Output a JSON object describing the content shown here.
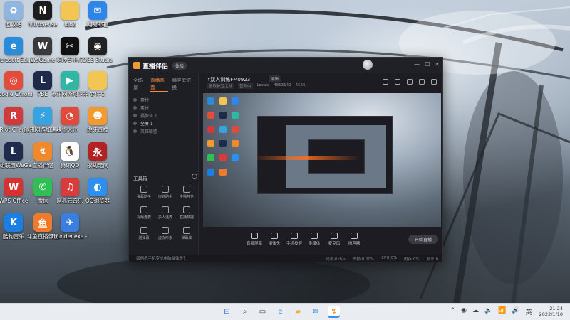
{
  "desktop": {
    "icons": [
      {
        "label": "回收站",
        "color": "#8fb6e0",
        "glyph": "♻"
      },
      {
        "label": "NitroSense",
        "color": "#1d1d1d",
        "glyph": "N"
      },
      {
        "label": "lqbz",
        "color": "#f3c552",
        "glyph": ""
      },
      {
        "label": "网易邮箱",
        "color": "#2f86ea",
        "glyph": "✉"
      },
      {
        "label": "Microsoft Edge",
        "color": "#2a8cd8",
        "glyph": "e"
      },
      {
        "label": "WeGame",
        "color": "#3a3a3a",
        "glyph": "W"
      },
      {
        "label": "剪映专业版",
        "color": "#111111",
        "glyph": "✂"
      },
      {
        "label": "OBS Studio",
        "color": "#222222",
        "glyph": "◉"
      },
      {
        "label": "Google Chrome",
        "color": "#e34b3c",
        "glyph": "◎"
      },
      {
        "label": "PBE",
        "color": "#1d2a4a",
        "glyph": "L"
      },
      {
        "label": "腾讯网游加速器",
        "color": "#2fb7a4",
        "glyph": "▶"
      },
      {
        "label": "文件夹",
        "color": "#f3c552",
        "glyph": ""
      },
      {
        "label": "Riot Client",
        "color": "#d13a3a",
        "glyph": "R"
      },
      {
        "label": "腾讯网游加速器",
        "color": "#37a3e0",
        "glyph": "⚡"
      },
      {
        "label": "鲁大师",
        "color": "#e04a3a",
        "glyph": "◔"
      },
      {
        "label": "虎牙直播",
        "color": "#f29a2e",
        "glyph": "☻"
      },
      {
        "label": "英雄联盟WeGame版",
        "color": "#1e2b4d",
        "glyph": "L"
      },
      {
        "label": "直播伴侣",
        "color": "#f0882c",
        "glyph": "↯"
      },
      {
        "label": "腾讯QQ",
        "color": "#ffffff",
        "glyph": "🐧"
      },
      {
        "label": "永劫无间",
        "color": "#b22222",
        "glyph": "永"
      },
      {
        "label": "WPS Office",
        "color": "#d6332f",
        "glyph": "W"
      },
      {
        "label": "微信",
        "color": "#2fbf55",
        "glyph": "✆"
      },
      {
        "label": "网易云音乐",
        "color": "#d93a3a",
        "glyph": "♫"
      },
      {
        "label": "QQ浏览器",
        "color": "#2d8ff0",
        "glyph": "◐"
      },
      {
        "label": "酷狗音乐",
        "color": "#1a7fe0",
        "glyph": "K"
      },
      {
        "label": "斗鱼直播伴侣",
        "color": "#f07a2c",
        "glyph": "鱼"
      },
      {
        "label": "Thunder.exe - 快捷方式",
        "color": "#3a7fdf",
        "glyph": "✈"
      }
    ]
  },
  "app": {
    "logo_text": "直播伴侣",
    "badge": "体验",
    "controls": [
      "—",
      "☐",
      "✕"
    ],
    "scene_tabs": [
      "全场景",
      "直播画面",
      "横竖屏切换"
    ],
    "sources": [
      {
        "label": "素材",
        "highlight": false
      },
      {
        "label": "素材",
        "highlight": false
      },
      {
        "label": "摄像头 1",
        "highlight": false
      },
      {
        "label": "全屏 1",
        "highlight": true
      },
      {
        "label": "英雄联盟",
        "highlight": false
      }
    ],
    "toolbox_title": "工具箱",
    "tools": [
      "弹幕助手",
      "房管助手",
      "主播任务",
      "视频连麦",
      "多人连麦",
      "直播数据",
      "送弹幕",
      "虚拟形象",
      "弹幕库"
    ],
    "stream_title": "Y双人训练FM0923",
    "edit_tag": "编辑",
    "stream_meta": [
      "游戏护卫之战",
      "营业中",
      "Locale",
      "4853142",
      "4565"
    ],
    "preview_icons": [
      "#2a8cd8",
      "#f3c552",
      "#2f86ea",
      "#e34b3c",
      "#1d2a4a",
      "#2fb7a4",
      "#d13a3a",
      "#37a3e0",
      "#e04a3a",
      "#f29a2e",
      "#1e2b4d",
      "#f0882c",
      "#2fbf55",
      "#d93a3a",
      "#2d8ff0",
      "#1a7fe0",
      "#f07a2c"
    ],
    "control_buttons": [
      "直播屏幕",
      "摄像头",
      "手机投屏",
      "多媒体",
      "麦克风",
      "扬声器"
    ],
    "start_button": "开始直播",
    "hint": "如何把手机变成电脑摄像头？",
    "stats": [
      "码率:0kb/s",
      "丢帧:0.00%",
      "CPU:0%",
      "内存:0%",
      "帧率:0"
    ]
  },
  "taskbar": {
    "apps": [
      {
        "name": "start",
        "glyph": "⊞",
        "color": "#1f6fe0",
        "active": false
      },
      {
        "name": "search",
        "glyph": "⌕",
        "color": "#333a44",
        "active": false
      },
      {
        "name": "task-view",
        "glyph": "▭",
        "color": "#333a44",
        "active": false
      },
      {
        "name": "edge",
        "glyph": "e",
        "color": "#2a8cd8",
        "active": false
      },
      {
        "name": "file-explorer",
        "glyph": "▰",
        "color": "#e8b33c",
        "active": false
      },
      {
        "name": "mail",
        "glyph": "✉",
        "color": "#2f86ea",
        "active": false
      },
      {
        "name": "live-companion",
        "glyph": "↯",
        "color": "#f0882c",
        "active": true
      }
    ],
    "tray_icons": [
      "^",
      "◉",
      "☁",
      "🔈",
      "📶",
      "🔊",
      "英"
    ],
    "time": "21:24",
    "date": "2022/1/10"
  }
}
